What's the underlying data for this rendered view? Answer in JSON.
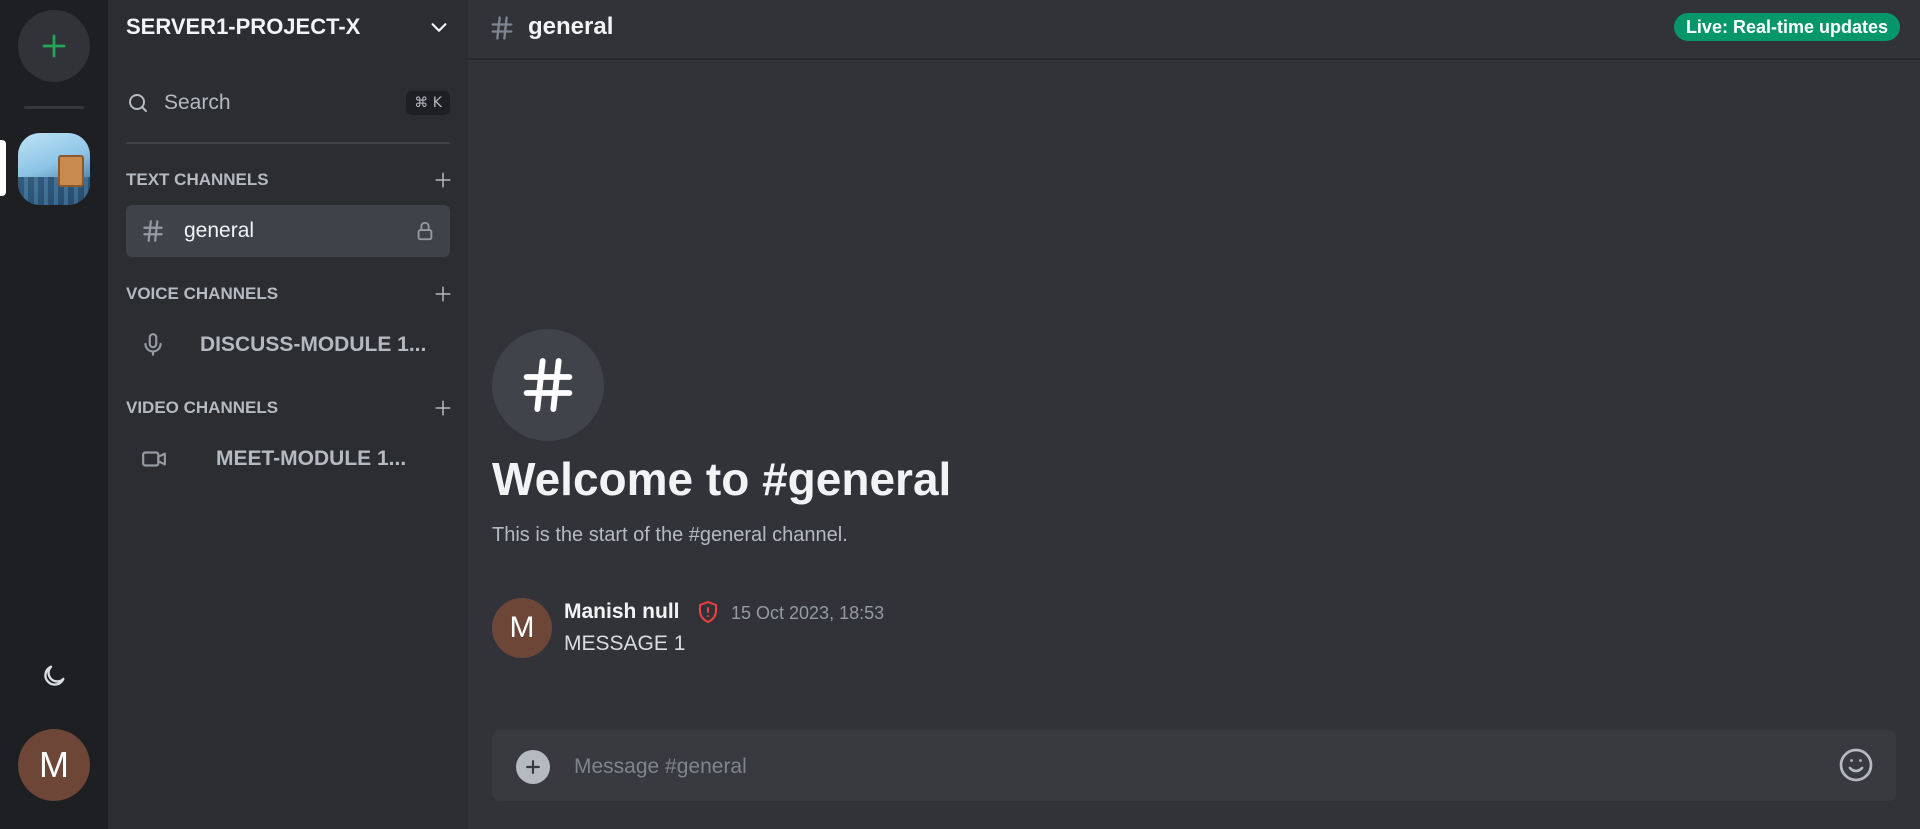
{
  "server_rail": {
    "add_icon": "plus-icon",
    "server_icon": "server-image-icon",
    "theme_icon": "moon-icon",
    "user_avatar_letter": "M"
  },
  "sidebar": {
    "server_name": "SERVER1-PROJECT-X",
    "search_label": "Search",
    "search_shortcut": "⌘ K",
    "categories": [
      {
        "label": "TEXT CHANNELS",
        "channels": [
          {
            "name": "general",
            "icon": "hash-icon",
            "locked": true,
            "active": true
          }
        ]
      },
      {
        "label": "VOICE CHANNELS",
        "channels": [
          {
            "name": "DISCUSS-MODULE 1...",
            "icon": "mic-icon"
          }
        ]
      },
      {
        "label": "VIDEO CHANNELS",
        "channels": [
          {
            "name": "MEET-MODULE 1...",
            "icon": "video-icon"
          }
        ]
      }
    ]
  },
  "header": {
    "channel_name": "general",
    "live_badge": "Live: Real-time updates",
    "live_badge_color": "#059669"
  },
  "welcome": {
    "title": "Welcome to #general",
    "subtitle": "This is the start of the #general channel."
  },
  "messages": [
    {
      "avatar_letter": "M",
      "author": "Manish null",
      "role_icon": "shield-alert-icon",
      "timestamp": "15 Oct 2023, 18:53",
      "text": "MESSAGE 1"
    }
  ],
  "composer": {
    "placeholder": "Message #general",
    "value": ""
  }
}
